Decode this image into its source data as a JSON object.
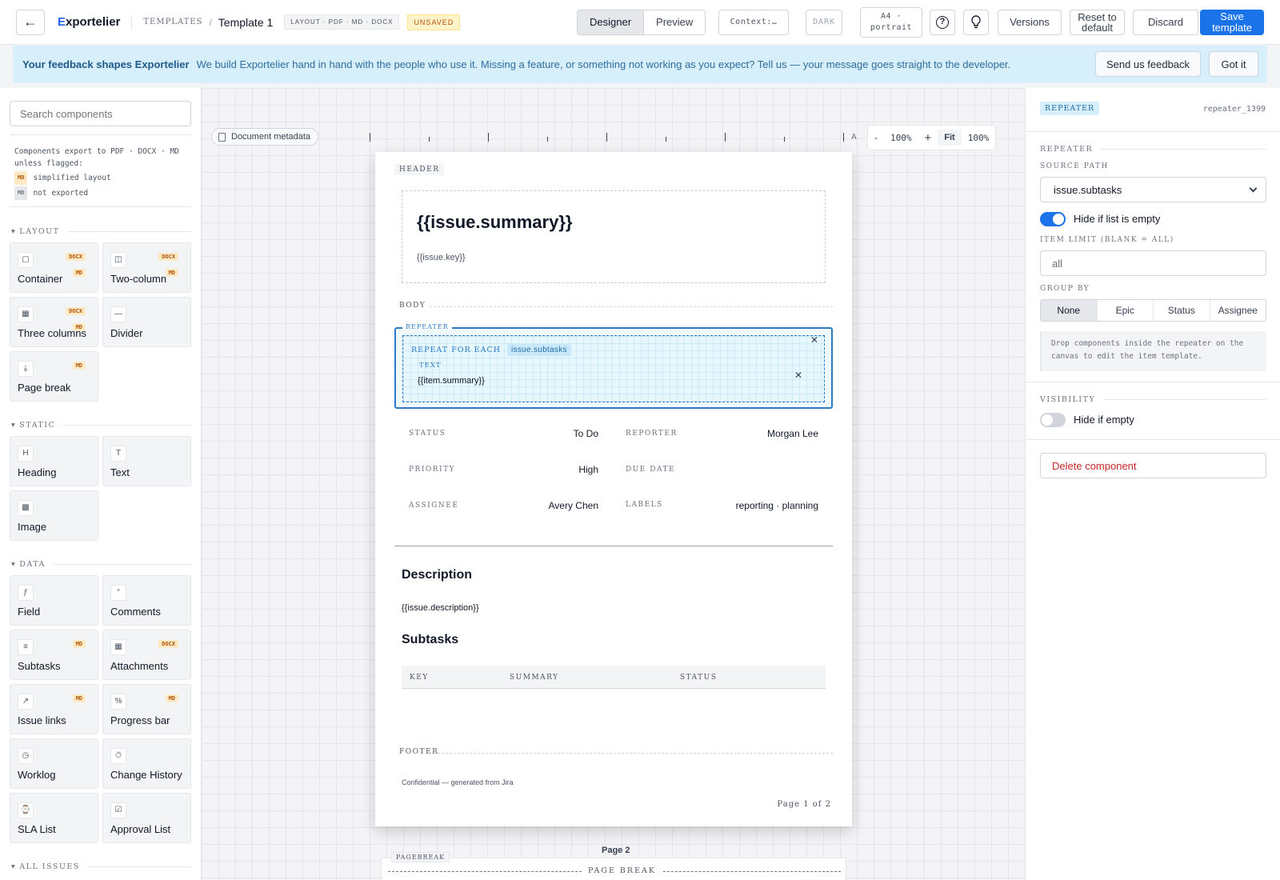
{
  "topbar": {
    "brand_first": "E",
    "brand_rest": "xportelier",
    "crumb_root": "TEMPLATES",
    "crumb_sep": "/",
    "crumb_current": "Template 1",
    "formats": "LAYOUT · PDF · MD · DOCX",
    "status": "UNSAVED",
    "modes": [
      "Designer",
      "Preview"
    ],
    "context": "Context:…",
    "theme": "DARK",
    "paper": "A4 · portrait",
    "help": "?",
    "versions": "Versions",
    "reset": "Reset to default",
    "discard": "Discard",
    "save": "Save template"
  },
  "banner": {
    "title": "Your feedback shapes Exportelier",
    "message": "We build Exportelier hand in hand with the people who use it. Missing a feature, or something not working as you expect? Tell us — your message goes straight to the developer.",
    "send_label": "Send us feedback",
    "dismiss_label": "Got it"
  },
  "sidebar": {
    "search_placeholder": "Search components",
    "legend_intro": "Components export to PDF · DOCX · MD unless flagged:",
    "legend_md_pill": "MD",
    "legend_md_text": "simplified layout",
    "legend_na_pill": "MD",
    "legend_na_text": "not exported",
    "sections": {
      "layout": "LAYOUT",
      "static": "STATIC",
      "data": "DATA",
      "all_issues": "ALL ISSUES"
    },
    "components": {
      "container": {
        "label": "Container",
        "icon": "▢",
        "pill1": "DOCX",
        "pill2": "MD"
      },
      "two_column": {
        "label": "Two-column",
        "icon": "◫",
        "pill1": "DOCX",
        "pill2": "MD"
      },
      "three_columns": {
        "label": "Three columns",
        "icon": "▦",
        "pill1": "DOCX",
        "pill2": "MD"
      },
      "divider": {
        "label": "Divider",
        "icon": "—"
      },
      "page_break": {
        "label": "Page break",
        "icon": "⤓",
        "pill1": "MD"
      },
      "heading": {
        "label": "Heading",
        "icon": "H"
      },
      "text": {
        "label": "Text",
        "icon": "T"
      },
      "image": {
        "label": "Image",
        "icon": "▩"
      },
      "field": {
        "label": "Field",
        "icon": "ƒ"
      },
      "comments": {
        "label": "Comments",
        "icon": "“"
      },
      "subtasks": {
        "label": "Subtasks",
        "icon": "≡",
        "pill1": "MD"
      },
      "attachments": {
        "label": "Attachments",
        "icon": "▦",
        "pill1": "DOCX"
      },
      "issue_links": {
        "label": "Issue links",
        "icon": "↗",
        "pill1": "MD"
      },
      "progress_bar": {
        "label": "Progress bar",
        "icon": "%",
        "pill1": "MD"
      },
      "worklog": {
        "label": "Worklog",
        "icon": "◷"
      },
      "change_history": {
        "label": "Change History",
        "icon": "⏱"
      },
      "sla_list": {
        "label": "SLA List",
        "icon": "⌚"
      },
      "approval_list": {
        "label": "Approval List",
        "icon": "☑"
      }
    }
  },
  "canvas": {
    "metadata_label": "Document metadata",
    "zoom": {
      "minus": "-",
      "value": "100%",
      "plus": "+",
      "fit": "Fit",
      "actual": "100%"
    },
    "ruler_end": "A",
    "page": {
      "header_label": "HEADER",
      "title": "{{issue.summary}}",
      "key": "{{issue.key}}",
      "body_label": "BODY",
      "repeater_label": "REPEATER",
      "repeat_for_each": "REPEAT FOR EACH",
      "repeat_path": "issue.subtasks",
      "text_label": "TEXT",
      "item_summary": "{{item.summary}}",
      "fields": {
        "status_label": "STATUS",
        "status_value": "To Do",
        "reporter_label": "REPORTER",
        "reporter_value": "Morgan Lee",
        "priority_label": "PRIORITY",
        "priority_value": "High",
        "due_label": "DUE DATE",
        "due_value": "",
        "assignee_label": "ASSIGNEE",
        "assignee_value": "Avery Chen",
        "labels_label": "LABELS",
        "labels_value": "reporting · planning"
      },
      "description_heading": "Description",
      "description_value": "{{issue.description}}",
      "subtasks_heading": "Subtasks",
      "table_headers": [
        "KEY",
        "SUMMARY",
        "STATUS"
      ],
      "footer_label": "FOOTER",
      "footer_text": "Confidential — generated from Jira",
      "page_number": "Page 1 of 2"
    },
    "page2_label": "Page 2",
    "pagebreak_tag": "PAGEBREAK",
    "pagebreak_text": "PAGE BREAK"
  },
  "inspector": {
    "type_badge": "REPEATER",
    "component_id": "repeater_1399",
    "section_repeater": "REPEATER",
    "source_path_label": "SOURCE PATH",
    "source_path_value": "issue.subtasks",
    "hide_if_list_empty_label": "Hide if list is empty",
    "hide_if_list_empty": true,
    "item_limit_label": "ITEM LIMIT (BLANK = ALL)",
    "item_limit_placeholder": "all",
    "group_by_label": "GROUP BY",
    "group_by_options": [
      "None",
      "Epic",
      "Status",
      "Assignee"
    ],
    "group_by_selected": "None",
    "note": "Drop components inside the repeater on the canvas to edit the item template.",
    "section_visibility": "VISIBILITY",
    "hide_if_empty_label": "Hide if empty",
    "hide_if_empty": false,
    "delete_label": "Delete component"
  },
  "colors": {
    "primary": "#1a73e8",
    "selection": "#2b7bc4",
    "banner_bg": "#d6effb",
    "unsaved": "#b45309",
    "danger": "#c62828"
  }
}
